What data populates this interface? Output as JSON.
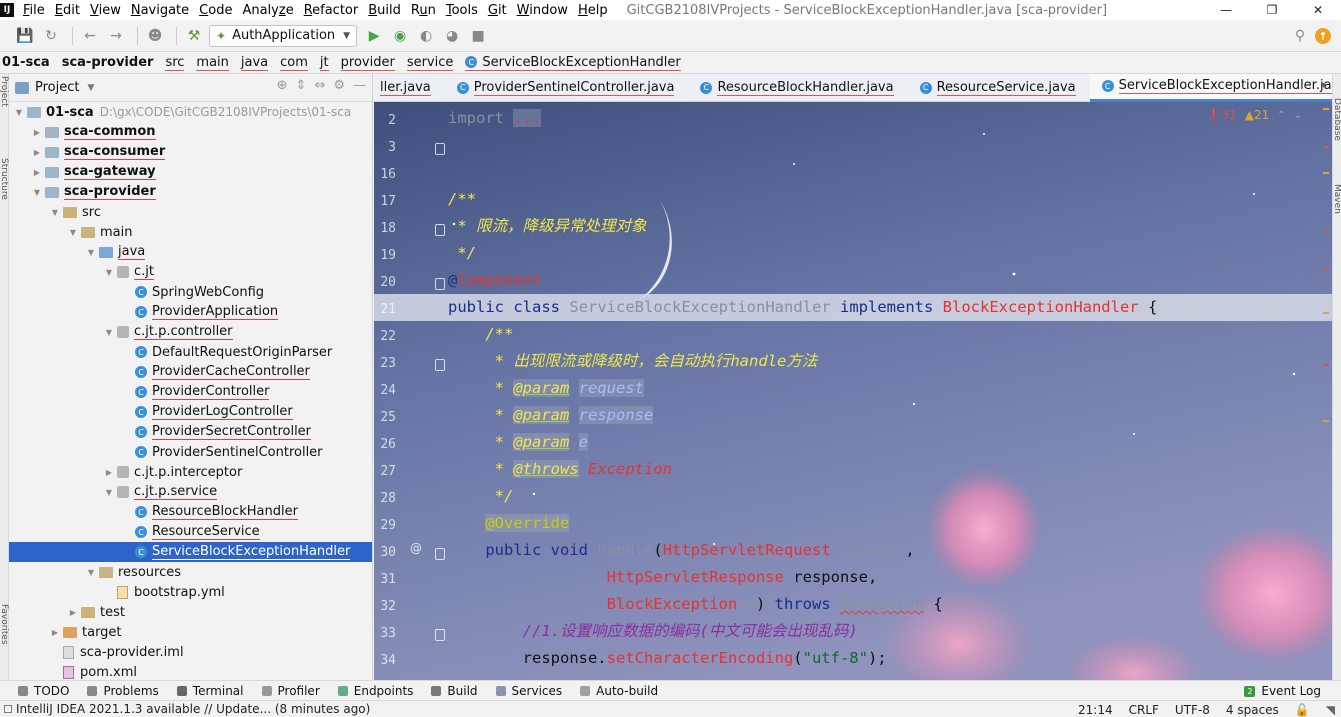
{
  "menubar": {
    "items": [
      {
        "label": "File",
        "underline": "F"
      },
      {
        "label": "Edit",
        "underline": "E"
      },
      {
        "label": "View",
        "underline": "V"
      },
      {
        "label": "Navigate",
        "underline": "N"
      },
      {
        "label": "Code",
        "underline": "C"
      },
      {
        "label": "Analyze",
        "underline": "z"
      },
      {
        "label": "Refactor",
        "underline": "R"
      },
      {
        "label": "Build",
        "underline": "B"
      },
      {
        "label": "Run",
        "underline": "u"
      },
      {
        "label": "Tools",
        "underline": "T"
      },
      {
        "label": "Git",
        "underline": "G"
      },
      {
        "label": "Window",
        "underline": "W"
      },
      {
        "label": "Help",
        "underline": "H"
      }
    ],
    "window_title": "GitCGB2108IVProjects - ServiceBlockExceptionHandler.java [sca-provider]"
  },
  "toolbar": {
    "run_config": "AuthApplication"
  },
  "breadcrumb": [
    "01-sca",
    "sca-provider",
    "src",
    "main",
    "java",
    "com",
    "jt",
    "provider",
    "service",
    "ServiceBlockExceptionHandler"
  ],
  "project": {
    "title": "Project",
    "root_label": "01-sca",
    "root_path": "D:\\gx\\CODE\\GitCGB2108IVProjects\\01-sca",
    "tree": [
      {
        "label": "sca-common",
        "bold": true
      },
      {
        "label": "sca-consumer",
        "bold": true
      },
      {
        "label": "sca-gateway",
        "bold": true
      },
      {
        "label": "sca-provider",
        "bold": true
      },
      {
        "label": "src"
      },
      {
        "label": "main"
      },
      {
        "label": "java"
      },
      {
        "label": "c.jt"
      },
      {
        "label": "SpringWebConfig"
      },
      {
        "label": "ProviderApplication"
      },
      {
        "label": "c.jt.p.controller"
      },
      {
        "label": "DefaultRequestOriginParser"
      },
      {
        "label": "ProviderCacheController"
      },
      {
        "label": "ProviderController"
      },
      {
        "label": "ProviderLogController"
      },
      {
        "label": "ProviderSecretController"
      },
      {
        "label": "ProviderSentinelController"
      },
      {
        "label": "c.jt.p.interceptor"
      },
      {
        "label": "c.jt.p.service"
      },
      {
        "label": "ResourceBlockHandler"
      },
      {
        "label": "ResourceService"
      },
      {
        "label": "ServiceBlockExceptionHandler"
      },
      {
        "label": "resources"
      },
      {
        "label": "bootstrap.yml"
      },
      {
        "label": "test"
      },
      {
        "label": "target"
      },
      {
        "label": "sca-provider.iml"
      },
      {
        "label": "pom.xml"
      }
    ]
  },
  "tabs": [
    {
      "label": "ller.java"
    },
    {
      "label": "ProviderSentinelController.java"
    },
    {
      "label": "ResourceBlockHandler.java"
    },
    {
      "label": "ResourceService.java"
    },
    {
      "label": "ServiceBlockExceptionHandler.java",
      "active": true
    }
  ],
  "inspections": {
    "errors": "31",
    "warnings": "21"
  },
  "editor": {
    "line_numbers": [
      "2",
      "3",
      "16",
      "17",
      "18",
      "19",
      "20",
      "21",
      "22",
      "23",
      "24",
      "25",
      "26",
      "27",
      "28",
      "29",
      "30",
      "31",
      "32",
      "33",
      "34"
    ],
    "tok": {
      "import_kw": "import",
      "import_dots": "...",
      "doc_open": "/**",
      "doc_title": " * 限流，降级异常处理对象",
      "doc_close": " */",
      "at": "@",
      "component": "Component",
      "public_kw": "public",
      "class_kw": "class",
      "class_name": "ServiceBlockExceptionHandler",
      "implements_kw": "implements",
      "iface_name": "BlockExceptionHandler",
      "brace_open": "{",
      "m_doc_open": "    /**",
      "m_doc_line1": "     * 出现限流或降级时，会自动执行handle方法",
      "star": "     * ",
      "param_tag": "@param",
      "p_request": "request",
      "p_response": "response",
      "p_e": "e",
      "throws_tag": "@throws",
      "exception_word": "Exception",
      "m_doc_close": "     */",
      "override": "@Override",
      "void_kw": "void",
      "handle": "handle",
      "paren": "(",
      "HttpServletRequest": "HttpServletRequest",
      "request": "request",
      "comma": ",",
      "HttpServletResponse": "HttpServletResponse",
      "response": "response",
      "BlockException": "BlockException",
      "e": "e",
      "close_paren": ")",
      "throws_kw": "throws",
      "Exception": "Exception",
      "comment1": "//1.设置响应数据的编码(中文可能会出现乱码)",
      "response_obj": "response.",
      "setCharEnc": "setCharacterEncoding",
      "utf8": "\"utf-8\"",
      "end_stmt": ");"
    }
  },
  "tool_windows": [
    "TODO",
    "Problems",
    "Terminal",
    "Profiler",
    "Endpoints",
    "Build",
    "Services",
    "Auto-build"
  ],
  "event_log": {
    "count": "2",
    "label": "Event Log"
  },
  "statusbar": {
    "message": "IntelliJ IDEA 2021.1.3 available // Update... (8 minutes ago)",
    "position": "21:14",
    "line_sep": "CRLF",
    "encoding": "UTF-8",
    "indent": "4 spaces"
  },
  "stripes": {
    "left_top": "Project",
    "left_mid": "Structure",
    "left_bot": "Favorites",
    "right_top": "Database",
    "right_mid": "Maven"
  },
  "colors": {
    "accent": "#2f65ca",
    "keyword": "#1a2d8a",
    "comment_doc": "#f0e74a",
    "type_ref": "#e8322e"
  }
}
